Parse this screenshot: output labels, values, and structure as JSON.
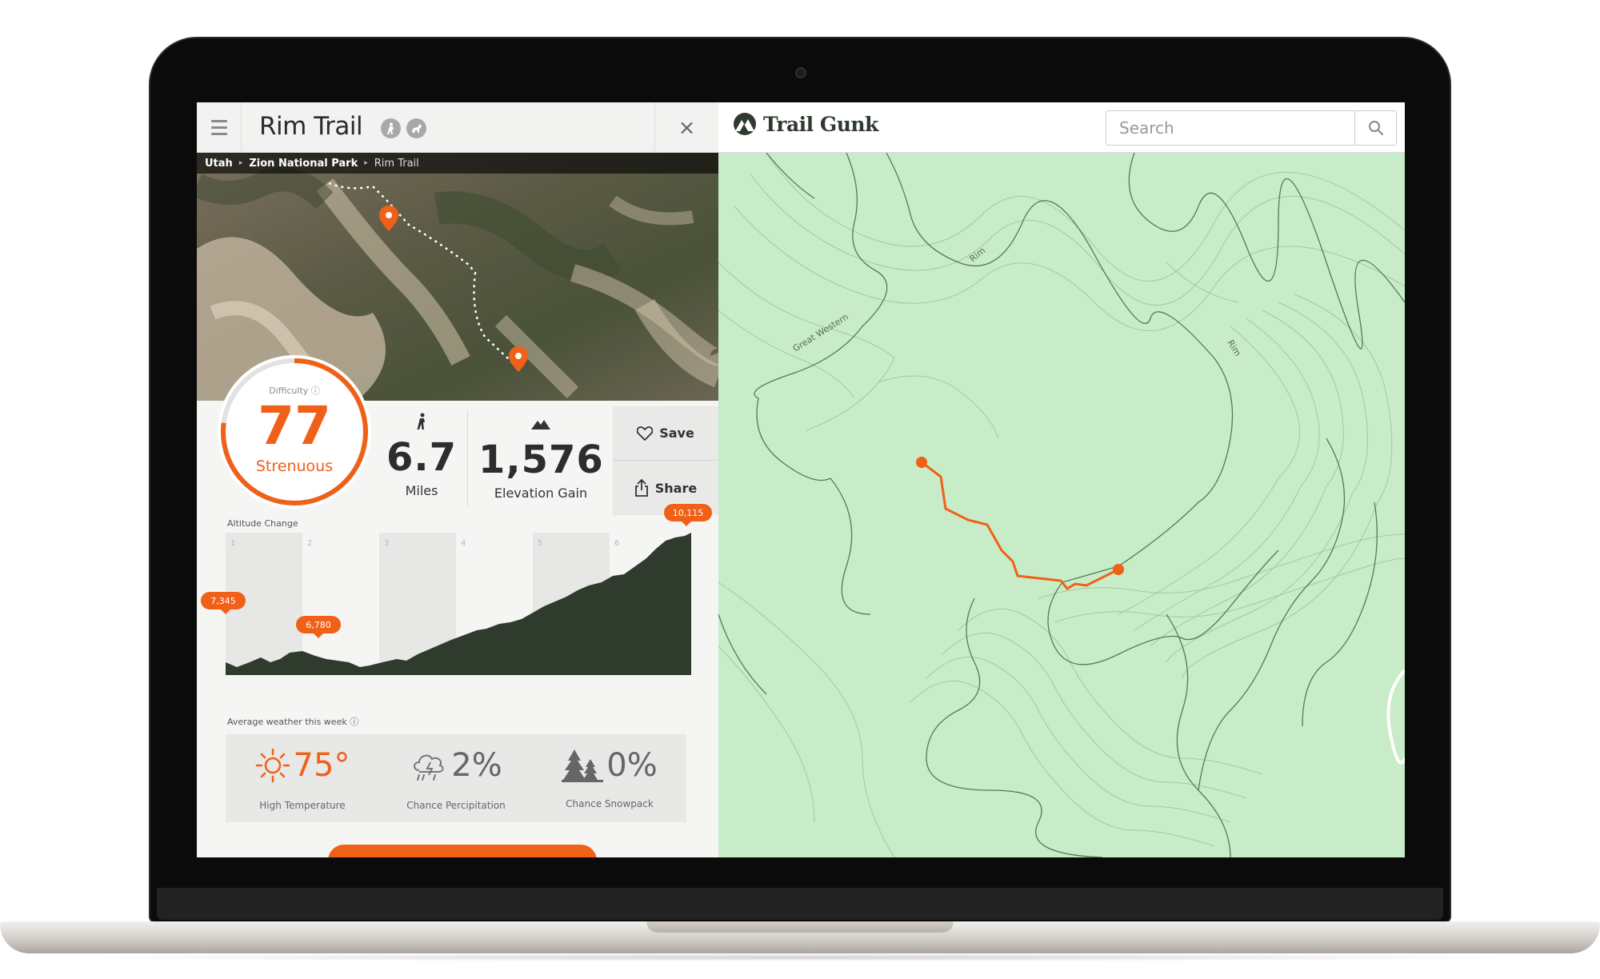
{
  "header": {
    "title": "Rim Trail",
    "close_label": "×"
  },
  "breadcrumb": [
    "Utah",
    "Zion National Park",
    "Rim Trail"
  ],
  "difficulty": {
    "label": "Difficulty",
    "score": "77",
    "level": "Strenuous",
    "progress": 0.77
  },
  "stats": {
    "distance_value": "6.7",
    "distance_label": "Miles",
    "elevation_value": "1,576",
    "elevation_label": "Elevation Gain"
  },
  "actions": {
    "save_label": "Save",
    "share_label": "Share"
  },
  "altitude": {
    "title": "Altitude Change",
    "mile_markers": [
      "1",
      "2",
      "3",
      "4",
      "5",
      "6"
    ],
    "start_label": "7,345",
    "low_label": "6,780",
    "high_label": "10,115"
  },
  "weather": {
    "title": "Average weather this week",
    "temp_value": "75°",
    "temp_label": "High Temperature",
    "precip_value": "2%",
    "precip_label": "Chance Percipitation",
    "snow_value": "0%",
    "snow_label": "Chance Snowpack"
  },
  "map": {
    "brand": "Trail Gunk",
    "search_placeholder": "Search",
    "labels": [
      "Rim",
      "Great Western",
      "Rim"
    ]
  },
  "colors": {
    "accent": "#f06018",
    "dark_green": "#2f3b2c",
    "map_green": "#c8ecc7",
    "map_lines": "#6e9d72"
  }
}
